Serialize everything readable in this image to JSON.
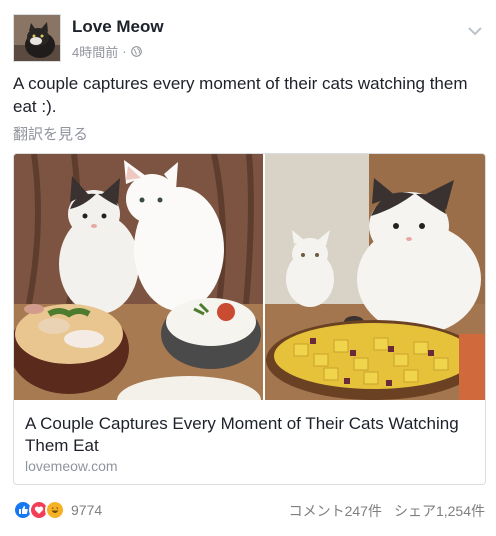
{
  "post": {
    "page_name": "Love Meow",
    "timestamp": "4時間前",
    "separator": "·",
    "message": "A couple captures every moment of their cats watching them eat :).",
    "translate_label": "翻訳を見る",
    "avatar_icon": "cat-avatar-icon",
    "privacy_icon": "globe-icon",
    "menu_icon": "chevron-down-icon"
  },
  "link_card": {
    "title": "A Couple Captures Every Moment of Their Cats Watching Them Eat",
    "domain": "lovemeow.com"
  },
  "footer": {
    "reaction_icons": [
      "like-icon",
      "love-icon",
      "haha-icon"
    ],
    "reaction_count": "9774",
    "comments": "コメント247件",
    "shares": "シェア1,254件"
  },
  "colors": {
    "like": "#1877f2",
    "love": "#f33e58",
    "haha": "#f7b125",
    "secondary_text": "#90949c"
  }
}
